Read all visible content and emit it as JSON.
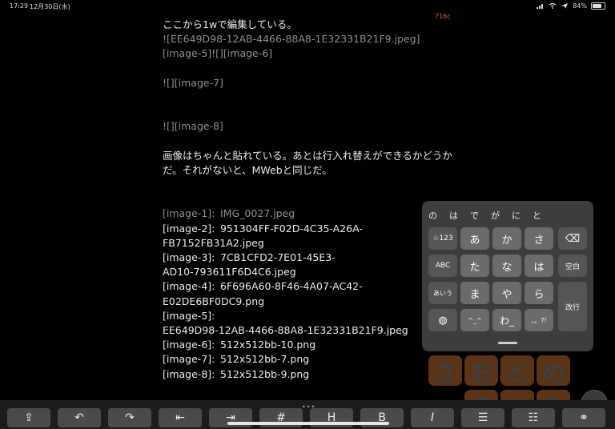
{
  "status": {
    "time": "17:29",
    "date": "12月30日(水)",
    "battery": "84%"
  },
  "char_count": "716c",
  "editor": {
    "lines_top": [
      {
        "text": "ここから1wで編集している。",
        "tone": "bright"
      },
      {
        "text": "![EE649D98-12AB-4466-88A8-1E32331B21F9.jpeg]",
        "tone": "dim"
      },
      {
        "text": "[image-5]![][image-6]",
        "tone": "dim"
      },
      {
        "text": "",
        "tone": "blank"
      },
      {
        "text": "![][image-7]",
        "tone": "dim"
      },
      {
        "text": "",
        "tone": "blank"
      },
      {
        "text": "",
        "tone": "blank"
      },
      {
        "text": "![][image-8]",
        "tone": "dim"
      },
      {
        "text": "",
        "tone": "blank"
      },
      {
        "text": "画像はちゃんと貼れている。あとは行入れ替えができるかどうか",
        "tone": "bright"
      },
      {
        "text": "だ。それがないと、MWebと同じだ。",
        "tone": "bright"
      }
    ],
    "refs": [
      {
        "key": "[image-1]:",
        "value": "IMG_0027.jpeg",
        "dim": true
      },
      {
        "key": "[image-2]:",
        "value": "951304FF-F02D-4C35-A26A-",
        "cont": "FB7152FB31A2.jpeg"
      },
      {
        "key": "[image-3]:",
        "value": "7CB1CFD2-7E01-45E3-",
        "cont": "AD10-793611F6D4C6.jpeg"
      },
      {
        "key": "[image-4]:",
        "value": "6F696A60-8F46-4A07-AC42-",
        "cont": "E02DE6BF0DC9.png"
      },
      {
        "key": "[image-5]:",
        "value": "",
        "cont": "EE649D98-12AB-4466-88A8-1E32331B21F9.jpeg"
      },
      {
        "key": "[image-6]:",
        "value": "512x512bb-10.png"
      },
      {
        "key": "[image-7]:",
        "value": "512x512bb-7.png"
      },
      {
        "key": "[image-8]:",
        "value": "512x512bb-9.png"
      }
    ]
  },
  "keyboard": {
    "candidates": [
      "の",
      "は",
      "で",
      "が",
      "に",
      "と"
    ],
    "keys": {
      "sym123": "☆123",
      "a": "あ",
      "ka": "か",
      "sa": "さ",
      "backspace": "⌫",
      "abc": "ABC",
      "ta": "た",
      "na": "な",
      "ha": "は",
      "space": "空白",
      "aiu": "あいう",
      "ma": "ま",
      "ya": "や",
      "ra": "ら",
      "enter": "改行",
      "globe": "◍",
      "kigo": "^_^",
      "wa": "わ_",
      "punct": "、。?!"
    }
  },
  "stamps": {
    "row1": [
      "さ",
      "お",
      "と",
      "め"
    ],
    "row2": [
      "ら",
      "い",
      "ふ"
    ]
  },
  "toolbar": {
    "share": "⇪",
    "undo": "↶",
    "redo": "↷",
    "outdent": "⇤",
    "indent": "⇥",
    "heading_hash": "#",
    "heading": "H",
    "bold": "B",
    "italic": "I",
    "list": "☰",
    "ordered_list": "☷",
    "link": "⚭"
  }
}
